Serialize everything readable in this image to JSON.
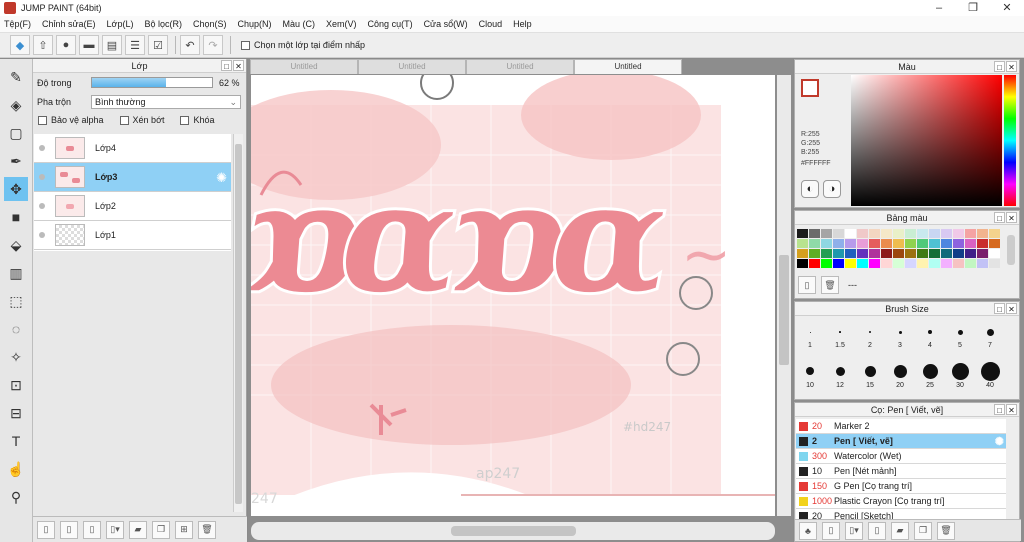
{
  "window": {
    "title": "JUMP PAINT (64bit)",
    "controls": [
      "–",
      "❐",
      "✕"
    ]
  },
  "menu": [
    "Tệp(F)",
    "Chỉnh sửa(E)",
    "Lớp(L)",
    "Bộ lọc(R)",
    "Chọn(S)",
    "Chụp(N)",
    "Màu (C)",
    "Xem(V)",
    "Công cụ(T)",
    "Cửa sổ(W)",
    "Cloud",
    "Help"
  ],
  "toolbar": {
    "select_layer_label": "Chọn một lớp tại điểm nhấp"
  },
  "layer_panel": {
    "title": "Lớp",
    "opacity_label": "Độ trong",
    "opacity_value": "62 %",
    "opacity_fraction": 0.62,
    "blend_label": "Pha trộn",
    "blend_value": "Bình thường",
    "protect_alpha": "Bảo vệ alpha",
    "clipping": "Xén bớt",
    "lock": "Khóa",
    "layers": [
      {
        "name": "Lớp4",
        "selected": false
      },
      {
        "name": "Lớp3",
        "selected": true
      },
      {
        "name": "Lớp2",
        "selected": false
      },
      {
        "name": "Lớp1",
        "selected": false
      }
    ]
  },
  "canvas": {
    "tabs": [
      "Untitled",
      "Untitled",
      "Untitled",
      "Untitled"
    ],
    "active_tab": 3,
    "watermark_1": "#hd247",
    "watermark_2": "ap247",
    "watermark_3": "247"
  },
  "color_panel": {
    "title": "Màu",
    "r": "R:255",
    "g": "G:255",
    "b": "B:255",
    "hex": "#FFFFFF"
  },
  "palette_panel": {
    "title": "Bảng màu",
    "bottom_text": "---",
    "colors": [
      "#1b1b1b",
      "#6b6b6b",
      "#a5a5a5",
      "#d8d8d8",
      "#ffffff",
      "#f0c9c9",
      "#f3d6c1",
      "#f5e8c8",
      "#e9f0c8",
      "#c9eed3",
      "#c9e9ef",
      "#c9d6f2",
      "#d9c9f2",
      "#f1c9e8",
      "#f5a3a3",
      "#f2b48e",
      "#f4d38d",
      "#b8e38f",
      "#8fdaa8",
      "#8fd7e2",
      "#8fb0ea",
      "#b79beb",
      "#e89dd8",
      "#e55d5d",
      "#ea8c4f",
      "#eebd4f",
      "#8fd24f",
      "#4fc97a",
      "#4fc1d3",
      "#4f86df",
      "#8d63df",
      "#d962c3",
      "#c92d2d",
      "#d66a1f",
      "#d4a01f",
      "#5fae24",
      "#249e52",
      "#1f98ad",
      "#1f5fbd",
      "#6432bd",
      "#b0329c",
      "#8c1a1a",
      "#9c4710",
      "#9c7110",
      "#3f7a14",
      "#146e36",
      "#106a7a",
      "#103e88",
      "#3f1f88",
      "#7a1f6c",
      "#ffffff",
      "#000000",
      "#ff0000",
      "#00ff00",
      "#0000ff",
      "#ffff00",
      "#00ffff",
      "#ff00ff",
      "#ffd6d6",
      "#d6ffd6",
      "#d6d6ff",
      "#fff3b0",
      "#b0fff3",
      "#f3b0ff",
      "#f6c2c2",
      "#c2f6c2",
      "#c2c2f6",
      "#e3e3e3"
    ]
  },
  "brush_panel": {
    "title": "Brush Size",
    "sizes_row1": [
      "1",
      "1.5",
      "2",
      "3",
      "4",
      "5",
      "7"
    ],
    "sizes_row2": [
      "10",
      "12",
      "15",
      "20",
      "25",
      "30",
      "40"
    ]
  },
  "tool_panel": {
    "title": "Cọ: Pen [ Viết, vẽ]",
    "items": [
      {
        "size": "20",
        "name": "Marker 2",
        "color": "#e53935",
        "selected": false
      },
      {
        "size": "2",
        "name": "Pen [ Viết, vẽ]",
        "color": "#222222",
        "selected": true
      },
      {
        "size": "300",
        "name": "Watercolor (Wet)",
        "color": "#7fd6ef",
        "selected": false
      },
      {
        "size": "10",
        "name": "Pen [Nét mảnh]",
        "color": "#222222",
        "selected": false
      },
      {
        "size": "150",
        "name": "G Pen [Cọ trang trí]",
        "color": "#e53935",
        "selected": false
      },
      {
        "size": "1000",
        "name": "Plastic Crayon [Cọ trang trí]",
        "color": "#f2d21b",
        "selected": false
      },
      {
        "size": "20",
        "name": "Pencil [Sketch]",
        "color": "#222222",
        "selected": false
      }
    ]
  }
}
